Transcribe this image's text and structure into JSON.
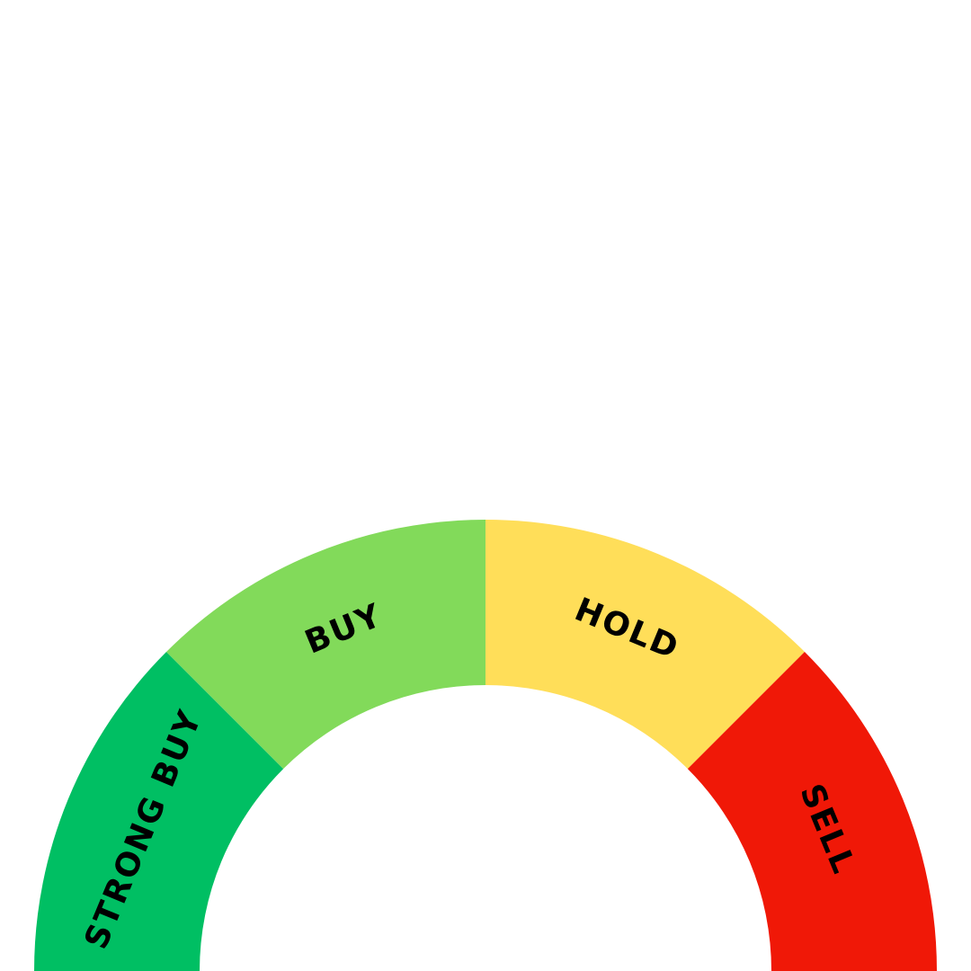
{
  "chart_data": {
    "type": "pie",
    "chart_style": "semicircle gauge",
    "categories": [
      "STRONG BUY",
      "BUY",
      "HOLD",
      "SELL"
    ],
    "values": [
      45,
      45,
      45,
      45
    ],
    "colors": [
      "#00BF63",
      "#82DA5A",
      "#FFDE59",
      "#F01807"
    ],
    "label_color": "#000000",
    "title": "",
    "legend": "none"
  }
}
